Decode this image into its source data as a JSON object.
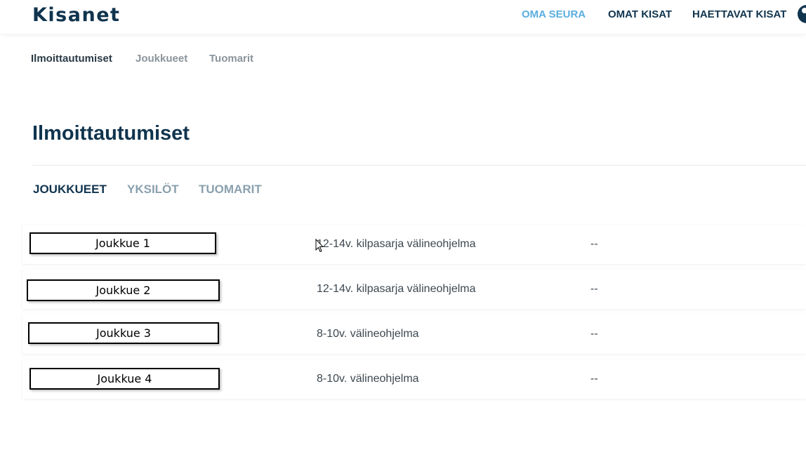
{
  "header": {
    "logo": "Kisanet",
    "nav": [
      {
        "label": "OMA SEURA"
      },
      {
        "label": "OMAT KISAT"
      },
      {
        "label": "HAETTAVAT KISAT"
      }
    ],
    "user_icon": "user-avatar-icon"
  },
  "subnav": [
    {
      "label": "Ilmoittautumiset"
    },
    {
      "label": "Joukkueet"
    },
    {
      "label": "Tuomarit"
    }
  ],
  "main": {
    "title": "Ilmoittautumiset",
    "tabs": [
      {
        "label": "JOUKKUEET"
      },
      {
        "label": "YKSILÖT"
      },
      {
        "label": "TUOMARIT"
      }
    ],
    "rows": [
      {
        "team": "Joukkue 1",
        "series": "12-14v. kilpasarja välineohjelma",
        "status": "--"
      },
      {
        "team": "Joukkue 2",
        "series": "12-14v. kilpasarja välineohjelma",
        "status": "--"
      },
      {
        "team": "Joukkue 3",
        "series": "8-10v. välineohjelma",
        "status": "--"
      },
      {
        "team": "Joukkue 4",
        "series": "8-10v. välineohjelma",
        "status": "--"
      }
    ]
  },
  "colors": {
    "brand_dark": "#10344e",
    "accent_blue": "#5aaedf",
    "muted_text": "#8a949b"
  }
}
